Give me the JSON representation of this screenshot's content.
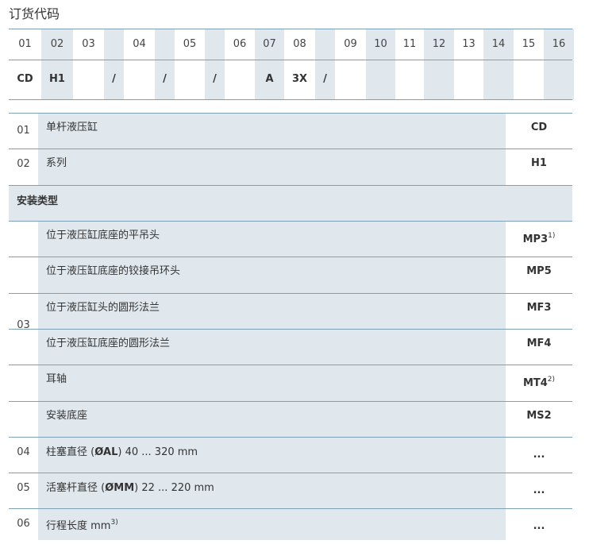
{
  "title": "订货代码",
  "code_grid": {
    "numbers": [
      "01",
      "02",
      "03",
      "",
      "04",
      "",
      "05",
      "",
      "06",
      "07",
      "08",
      "",
      "09",
      "10",
      "11",
      "12",
      "13",
      "14",
      "15",
      "16"
    ],
    "codes": [
      "CD",
      "H1",
      "",
      "/",
      "",
      "/",
      "",
      "/",
      "",
      "A",
      "3X",
      "/",
      "",
      "",
      "",
      "",
      "",
      "",
      "",
      ""
    ],
    "shaded": [
      false,
      true,
      false,
      true,
      false,
      true,
      false,
      true,
      false,
      true,
      false,
      true,
      false,
      true,
      false,
      true,
      false,
      true,
      false,
      true
    ]
  },
  "rows": {
    "r01": {
      "idx": "01",
      "desc": "单杆液压缸",
      "val": "CD"
    },
    "r02": {
      "idx": "02",
      "desc": "系列",
      "val": "H1"
    },
    "section": "安装类型",
    "idx03": "03",
    "mount": [
      {
        "desc": "位于液压缸底座的平吊头",
        "val": "MP3",
        "sup": "1)"
      },
      {
        "desc": "位于液压缸底座的铰接吊环头",
        "val": "MP5",
        "sup": ""
      },
      {
        "desc": "位于液压缸头的圆形法兰",
        "val": "MF3",
        "sup": ""
      },
      {
        "desc": "位于液压缸底座的圆形法兰",
        "val": "MF4",
        "sup": ""
      },
      {
        "desc": "耳轴",
        "val": "MT4",
        "sup": "2)"
      },
      {
        "desc": "安装底座",
        "val": "MS2",
        "sup": ""
      }
    ],
    "r04": {
      "idx": "04",
      "pre": "柱塞直径 (",
      "bold": "ØAL",
      "post": ") 40 ... 320 mm",
      "val": "..."
    },
    "r05": {
      "idx": "05",
      "pre": "活塞杆直径 (",
      "bold": "ØMM",
      "post": ") 22 ... 220 mm",
      "val": "..."
    },
    "r06": {
      "idx": "06",
      "pre": "行程长度 mm",
      "sup": "3)",
      "val": "..."
    }
  }
}
